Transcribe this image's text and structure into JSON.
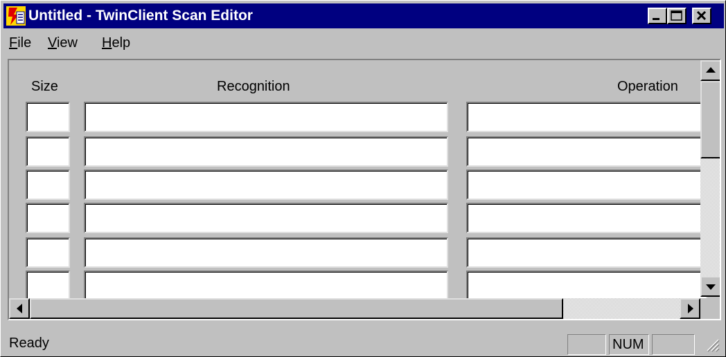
{
  "window": {
    "title": "Untitled - TwinClient Scan Editor"
  },
  "menu": {
    "items": [
      {
        "label": "File",
        "underline": "F",
        "rest": "ile"
      },
      {
        "label": "View",
        "underline": "V",
        "rest": "iew"
      },
      {
        "label": "Help",
        "underline": "H",
        "rest": "elp"
      }
    ]
  },
  "grid": {
    "headers": {
      "size": "Size",
      "recognition": "Recognition",
      "operation": "Operation"
    },
    "rows": [
      {
        "size": "",
        "recognition": "",
        "operation": ""
      },
      {
        "size": "",
        "recognition": "",
        "operation": ""
      },
      {
        "size": "",
        "recognition": "",
        "operation": ""
      },
      {
        "size": "",
        "recognition": "",
        "operation": ""
      },
      {
        "size": "",
        "recognition": "",
        "operation": ""
      },
      {
        "size": "",
        "recognition": "",
        "operation": ""
      }
    ]
  },
  "status": {
    "text": "Ready",
    "panes": [
      "",
      "NUM",
      ""
    ]
  },
  "colors": {
    "titlebar": "#000080",
    "face": "#c0c0c0"
  },
  "icons": [
    "app-icon",
    "minimize-icon",
    "maximize-icon",
    "close-icon",
    "arrow-up-icon",
    "arrow-down-icon",
    "arrow-left-icon",
    "arrow-right-icon",
    "size-grip-icon"
  ]
}
